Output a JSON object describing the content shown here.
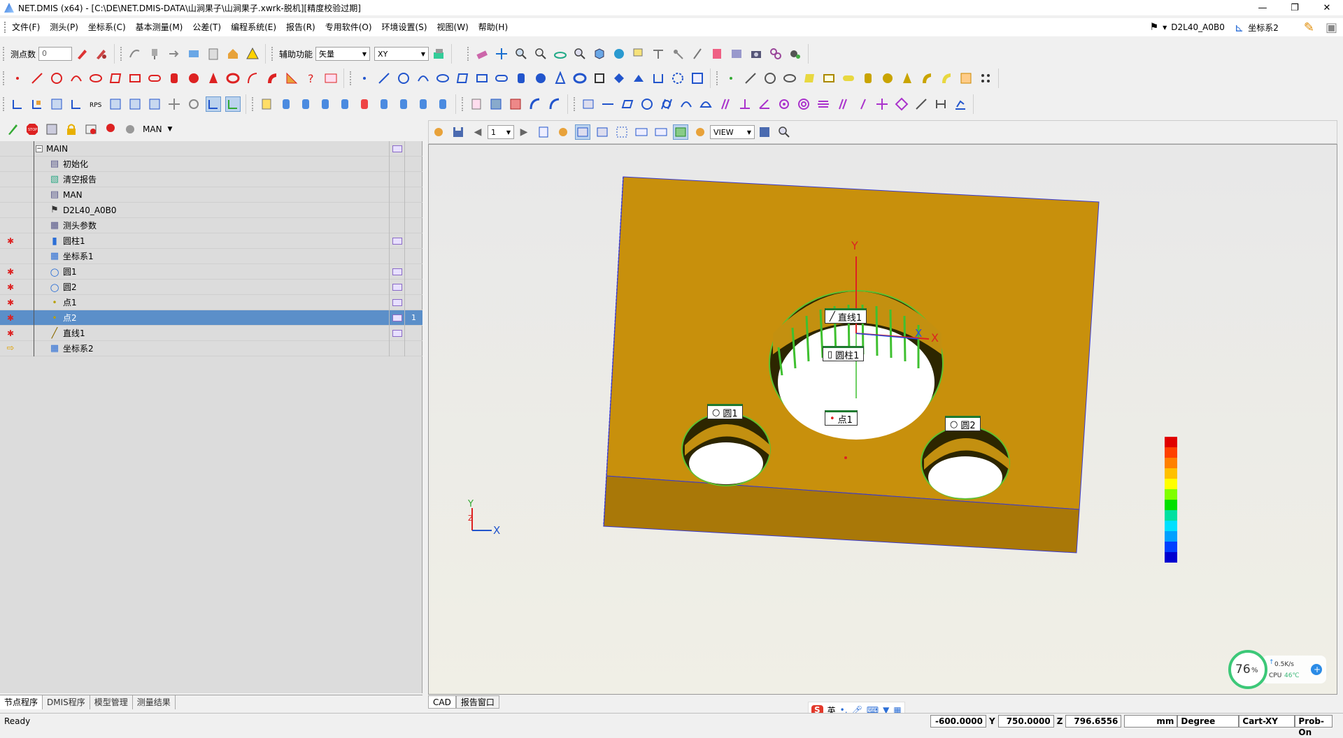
{
  "window": {
    "title": "NET.DMIS (x64) - [C:\\DE\\NET.DMIS-DATA\\山涧果子\\山涧果子.xwrk-脱机][精度校验过期]",
    "controls": [
      "—",
      "❐",
      "✕"
    ]
  },
  "menu": {
    "items": [
      "文件(F)",
      "测头(P)",
      "坐标系(C)",
      "基本测量(M)",
      "公差(T)",
      "编程系统(E)",
      "报告(R)",
      "专用软件(O)",
      "环境设置(S)",
      "视图(W)",
      "帮助(H)"
    ],
    "probe": "D2L40_A0B0",
    "coord_system": "坐标系2"
  },
  "toolbar": {
    "point_count_label": "测点数",
    "point_count_value": "0",
    "aux_label": "辅助功能",
    "aux_value": "矢量",
    "plane_value": "XY",
    "mode_value": "MAN"
  },
  "tree": {
    "rows": [
      {
        "label": "MAIN",
        "icon": "minus-box-icon",
        "marker": "",
        "badge": "",
        "num": ""
      },
      {
        "label": "初始化",
        "icon": "init-icon",
        "marker": "",
        "badge": "",
        "num": ""
      },
      {
        "label": "清空报告",
        "icon": "clear-report-icon",
        "marker": "",
        "badge": "",
        "num": ""
      },
      {
        "label": "MAN",
        "icon": "mode-icon",
        "marker": "",
        "badge": "",
        "num": ""
      },
      {
        "label": "D2L40_A0B0",
        "icon": "probe-icon",
        "marker": "",
        "badge": "",
        "num": ""
      },
      {
        "label": "测头参数",
        "icon": "probe-param-icon",
        "marker": "",
        "badge": "",
        "num": ""
      },
      {
        "label": "圆柱1",
        "icon": "cylinder-icon",
        "marker": "bulb",
        "badge": "yes",
        "num": ""
      },
      {
        "label": "坐标系1",
        "icon": "coord-icon",
        "marker": "",
        "badge": "",
        "num": ""
      },
      {
        "label": "圆1",
        "icon": "circle-icon",
        "marker": "bulb",
        "badge": "yes",
        "num": ""
      },
      {
        "label": "圆2",
        "icon": "circle-icon",
        "marker": "bulb",
        "badge": "yes",
        "num": ""
      },
      {
        "label": "点1",
        "icon": "point-icon",
        "marker": "bulb",
        "badge": "yes",
        "num": ""
      },
      {
        "label": "点2",
        "icon": "point-icon",
        "marker": "bulb",
        "badge": "yes",
        "num": "1"
      },
      {
        "label": "直线1",
        "icon": "line-icon",
        "marker": "bulb",
        "badge": "yes",
        "num": ""
      },
      {
        "label": "坐标系2",
        "icon": "coord-icon",
        "marker": "arrow",
        "badge": "",
        "num": ""
      }
    ],
    "selected_index": 11
  },
  "left_tabs": [
    "节点程序",
    "DMIS程序",
    "模型管理",
    "测量结果"
  ],
  "view_toolbar": {
    "page_value": "1",
    "view_value": "VIEW"
  },
  "view_tabs": [
    "CAD",
    "报告窗口"
  ],
  "cad": {
    "labels": {
      "line1": "直线1",
      "cyl1": "圆柱1",
      "circle1": "圆1",
      "circle2": "圆2",
      "point1": "点1"
    },
    "axis_x": "X",
    "axis_y": "Y",
    "axis_z": "Z",
    "small_axis_x": "X",
    "small_axis_y": "Y",
    "small_axis_z": "Z"
  },
  "colors": {
    "part": "#c8900c",
    "part_dark": "#a97808",
    "selection": "#5b8fc9"
  },
  "cpu": {
    "percent": "76",
    "percent_sign": "%",
    "speed": "0.5K/s",
    "cpu_label": "CPU",
    "temp": "46℃"
  },
  "status": {
    "ready": "Ready",
    "x": "-600.0000",
    "y_label": "Y",
    "y": "750.0000",
    "z_label": "Z",
    "z": "796.6556",
    "unit": "mm",
    "angle": "Degree",
    "coord_mode": "Cart-XY",
    "probe_state": "Prob-On"
  },
  "ime": {
    "lang": "英"
  }
}
